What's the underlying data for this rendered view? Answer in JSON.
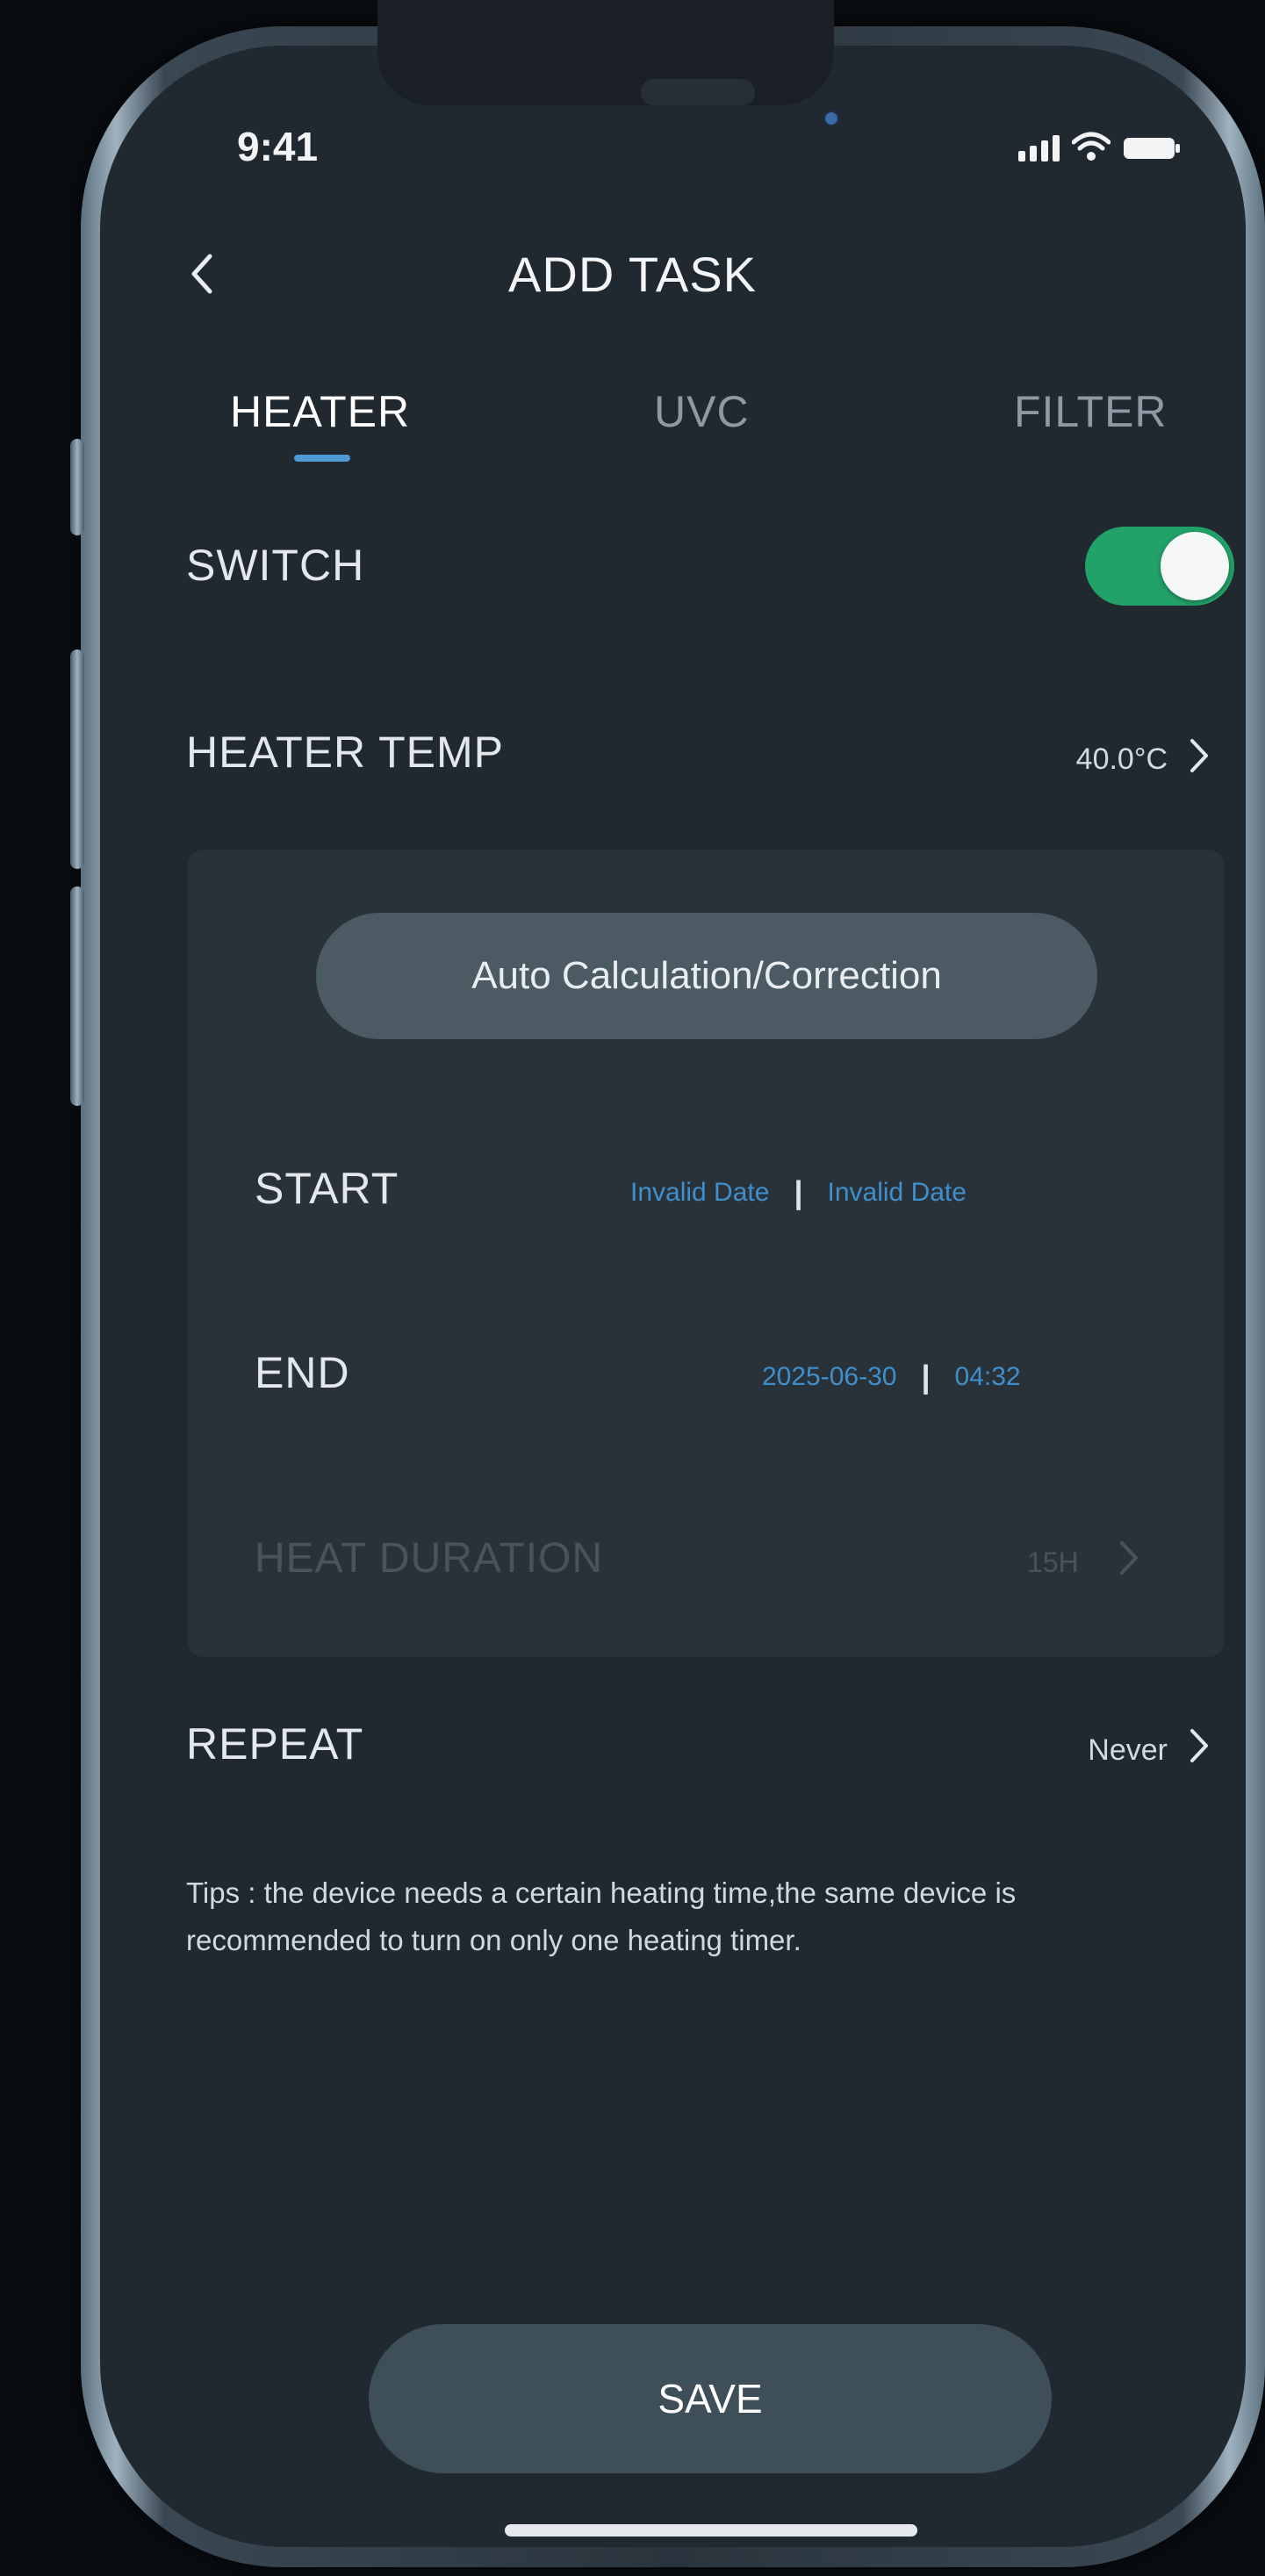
{
  "status_bar": {
    "time": "9:41"
  },
  "nav": {
    "title": "ADD TASK"
  },
  "tabs": [
    {
      "label": "HEATER",
      "active": true
    },
    {
      "label": "UVC",
      "active": false
    },
    {
      "label": "FILTER",
      "active": false
    }
  ],
  "settings": {
    "switch": {
      "label": "SWITCH",
      "on": true
    },
    "heater_temp": {
      "label": "HEATER TEMP",
      "value": "40.0°C"
    },
    "auto_button": "Auto Calculation/Correction",
    "start": {
      "label": "START",
      "date": "Invalid Date",
      "time": "Invalid Date"
    },
    "end": {
      "label": "END",
      "date": "2025-06-30",
      "time": "04:32"
    },
    "heat_duration": {
      "label": "HEAT DURATION",
      "value": "15H"
    },
    "repeat": {
      "label": "REPEAT",
      "value": "Never"
    }
  },
  "tips": "Tips : the device needs a certain heating time,the same device is recommended to turn on only one heating timer.",
  "save_label": "SAVE",
  "colors": {
    "accent": "#4e9bd6",
    "toggle_on": "#22a268",
    "date_link": "#3f8fcc",
    "background": "#202830"
  }
}
